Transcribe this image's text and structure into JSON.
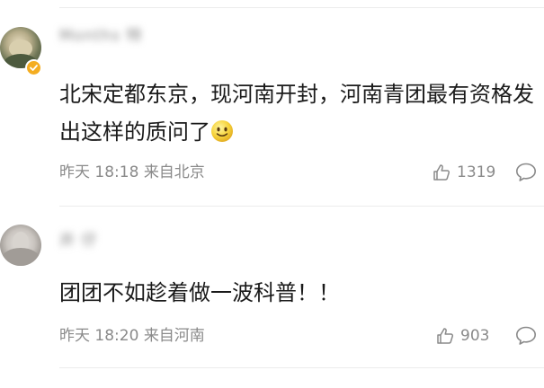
{
  "comments": [
    {
      "username": "Months 特",
      "verified": true,
      "text": "北宋定都东京，现河南开封，河南青团最有资格发出这样的质问了",
      "emoji": "smile-emoji",
      "time": "昨天 18:18",
      "source": "来自北京",
      "likes": "1319"
    },
    {
      "username": "井 仔",
      "verified": false,
      "text": "团团不如趁着做一波科普！！",
      "time": "昨天 18:20",
      "source": "来自河南",
      "likes": "903"
    }
  ],
  "icons": {
    "like": "thumbs-up-icon",
    "reply": "comment-bubble-icon",
    "verified": "verified-badge-icon"
  },
  "colors": {
    "text": "#1a1a1a",
    "meta": "#8a8a8a",
    "verified": "#f4ad21",
    "divider": "#ececec"
  }
}
